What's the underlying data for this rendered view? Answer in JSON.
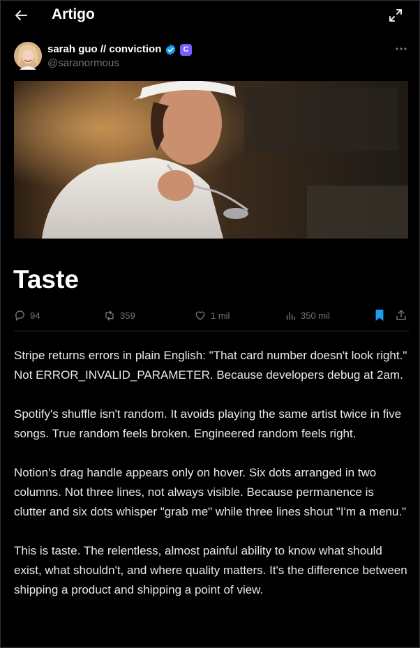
{
  "header": {
    "title": "Artigo",
    "back_icon": "arrow-left-icon",
    "expand_icon": "expand-icon"
  },
  "author": {
    "name": "sarah guo // conviction",
    "handle": "@saranormous",
    "verified_icon": "verified-badge-icon",
    "affiliate_badge": "C",
    "more_icon": "more-horizontal-icon"
  },
  "article": {
    "title": "Taste",
    "paragraphs": [
      "Stripe returns errors in plain English: \"That card number doesn't look right.\" Not ERROR_INVALID_PARAMETER. Because developers debug at 2am.",
      "Spotify's shuffle isn't random. It avoids playing the same artist twice in five songs. True random feels broken. Engineered random feels right.",
      "Notion's drag handle appears only on hover. Six dots arranged in two columns. Not three lines, not always visible. Because permanence is clutter and six dots whisper \"grab me\" while three lines shout \"I'm a menu.\"",
      "This is taste. The relentless, almost painful ability to know what should exist, what shouldn't, and where quality matters. It's the difference between shipping a product and shipping a point of view."
    ]
  },
  "stats": {
    "replies": "94",
    "reposts": "359",
    "likes": "1 mil",
    "views": "350 mil"
  },
  "colors": {
    "background": "#000000",
    "text": "#e7e9ea",
    "muted": "#71767b",
    "accent": "#1d9bf0",
    "divider": "#2f3336"
  }
}
